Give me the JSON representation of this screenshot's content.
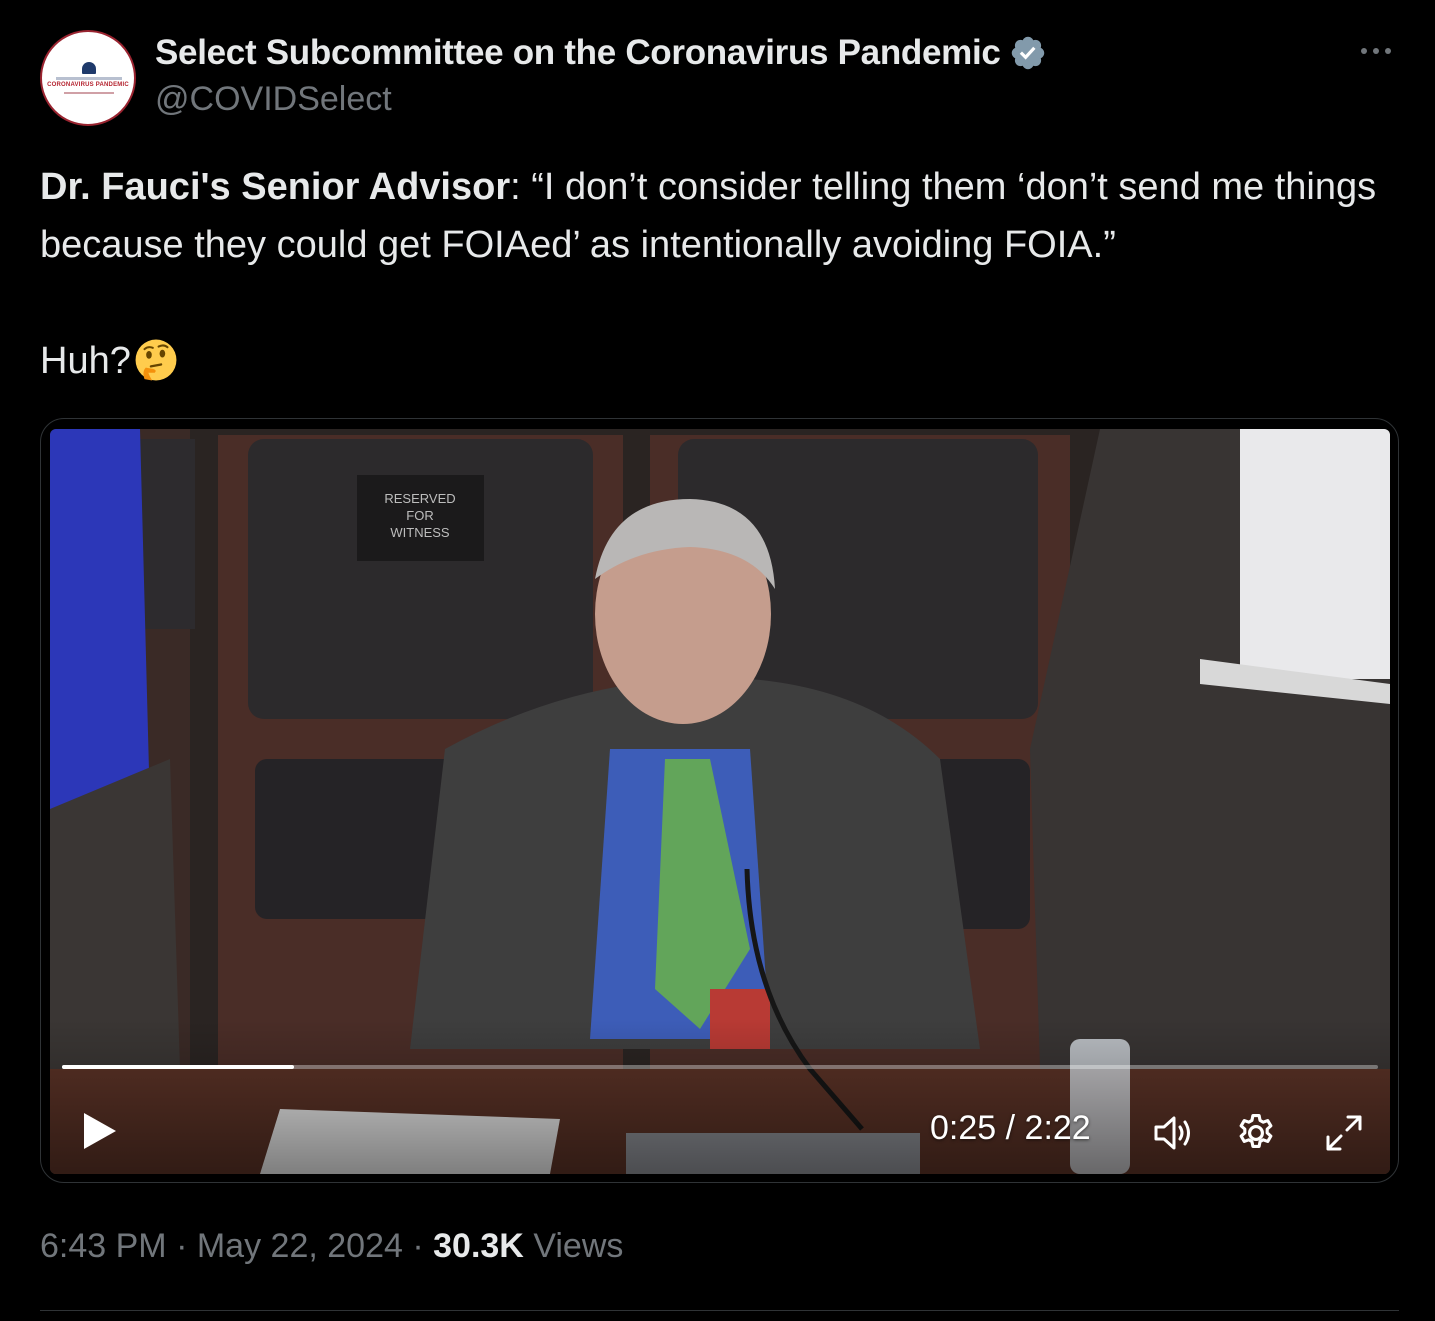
{
  "account": {
    "display_name": "Select Subcommittee on the Coronavirus Pandemic",
    "handle": "@COVIDSelect",
    "verified": true,
    "avatar_text": "CORONAVIRUS PANDEMIC"
  },
  "tweet": {
    "bold_lead": "Dr. Fauci's Senior Advisor",
    "quote": ": “I don’t consider telling them ‘don’t send me things because they could get FOIAed’ as intentionally avoiding FOIA.”",
    "reaction": "Huh?",
    "emoji": "thinking-face"
  },
  "video": {
    "sign_text": "RESERVED FOR WITNESS",
    "current_time": "0:25",
    "separator": "/",
    "duration": "2:22",
    "progress_fraction": 0.176,
    "controls": [
      "play-icon",
      "volume-icon",
      "settings-icon",
      "fullscreen-icon"
    ]
  },
  "footer": {
    "time": "6:43 PM",
    "dot": "·",
    "date": "May 22, 2024",
    "views_count": "30.3K",
    "views_label": "Views"
  },
  "colors": {
    "background": "#000000",
    "primary_text": "#e7e9ea",
    "secondary_text": "#71767b",
    "verified_badge": "#829aab",
    "border": "#2f3336"
  }
}
